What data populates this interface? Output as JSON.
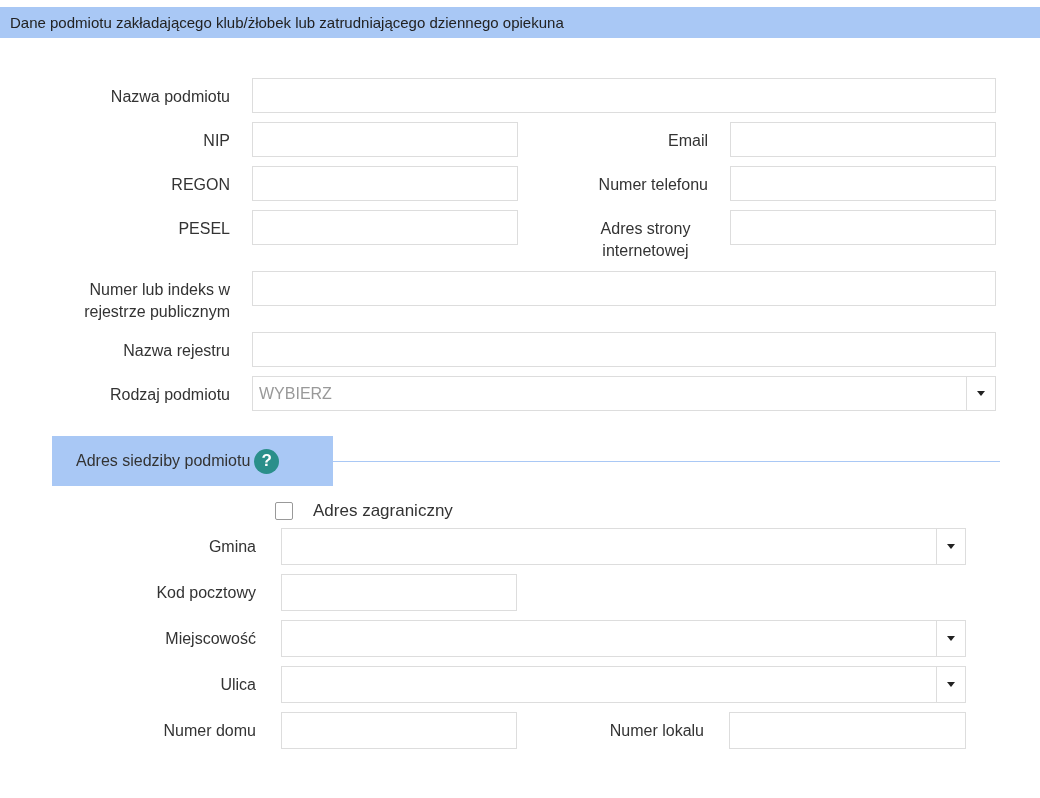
{
  "header": {
    "title": "Dane podmiotu zakładającego klub/żłobek lub zatrudniającego dziennego opiekuna"
  },
  "entity": {
    "rows": [
      {
        "kind": "wide",
        "fields": [
          {
            "label": "Nazwa podmiotu"
          }
        ]
      },
      {
        "kind": "pair",
        "fields": [
          {
            "label": "NIP"
          },
          {
            "label": "Email"
          }
        ]
      },
      {
        "kind": "pair",
        "fields": [
          {
            "label": "REGON"
          },
          {
            "label": "Numer telefonu"
          }
        ]
      },
      {
        "kind": "pair",
        "fields": [
          {
            "label": "PESEL"
          },
          {
            "label": "Adres strony internetowej"
          }
        ]
      },
      {
        "kind": "wide",
        "fields": [
          {
            "label": "Numer lub indeks w rejestrze publicznym"
          }
        ]
      },
      {
        "kind": "wide",
        "fields": [
          {
            "label": "Nazwa rejestru"
          }
        ]
      },
      {
        "kind": "dropdown",
        "fields": [
          {
            "label": "Rodzaj podmiotu",
            "placeholder": "WYBIERZ"
          }
        ]
      }
    ]
  },
  "address": {
    "title": "Adres siedziby podmiotu",
    "help": "?",
    "foreign": {
      "label": "Adres zagraniczny",
      "checked": false
    },
    "rows": [
      {
        "kind": "dropdown",
        "fields": [
          {
            "label": "Gmina"
          }
        ]
      },
      {
        "kind": "single",
        "fields": [
          {
            "label": "Kod pocztowy"
          }
        ]
      },
      {
        "kind": "dropdown",
        "fields": [
          {
            "label": "Miejscowość"
          }
        ]
      },
      {
        "kind": "dropdown",
        "fields": [
          {
            "label": "Ulica"
          }
        ]
      },
      {
        "kind": "pair",
        "fields": [
          {
            "label": "Numer domu"
          },
          {
            "label": "Numer lokalu"
          }
        ]
      }
    ]
  }
}
